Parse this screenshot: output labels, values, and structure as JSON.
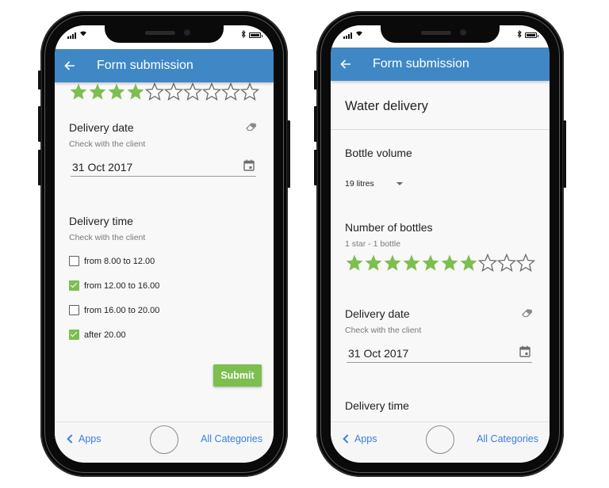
{
  "colors": {
    "appbar": "#3f88c5",
    "accent_green": "#7cbf4f",
    "link_blue": "#3b7ee0"
  },
  "left_phone": {
    "appbar": {
      "back_icon": "arrow-left-icon",
      "title": "Form submission"
    },
    "rating": {
      "filled": 4,
      "total": 10
    },
    "delivery_date": {
      "title": "Delivery date",
      "help": "Check with the client",
      "value": "31 Oct 2017",
      "clear_icon": "eraser-icon",
      "calendar_icon": "calendar-icon"
    },
    "delivery_time": {
      "title": "Delivery time",
      "help": "Check with the client",
      "options": [
        {
          "label": "from 8.00 to 12.00",
          "checked": false
        },
        {
          "label": "from 12.00 to 16.00",
          "checked": true
        },
        {
          "label": "from 16.00 to 20.00",
          "checked": false
        },
        {
          "label": "after 20.00",
          "checked": true
        }
      ]
    },
    "submit_label": "Submit",
    "bottom_bar": {
      "back_label": "Apps",
      "right_label": "All Categories"
    }
  },
  "right_phone": {
    "appbar": {
      "back_icon": "arrow-left-icon",
      "title": "Form submission"
    },
    "form_title": "Water delivery",
    "bottle_volume": {
      "title": "Bottle volume",
      "selected": "19 litres"
    },
    "number_of_bottles": {
      "title": "Number of bottles",
      "help": "1 star - 1 bottle",
      "rating": {
        "filled": 7,
        "total": 10
      }
    },
    "delivery_date": {
      "title": "Delivery date",
      "help": "Check with the client",
      "value": "31 Oct 2017",
      "clear_icon": "eraser-icon",
      "calendar_icon": "calendar-icon"
    },
    "delivery_time": {
      "title": "Delivery time"
    },
    "bottom_bar": {
      "back_label": "Apps",
      "right_label": "All Categories"
    }
  },
  "status_bar": {
    "icons": [
      "signal-icon",
      "wifi-icon",
      "bluetooth-icon",
      "battery-icon"
    ]
  }
}
